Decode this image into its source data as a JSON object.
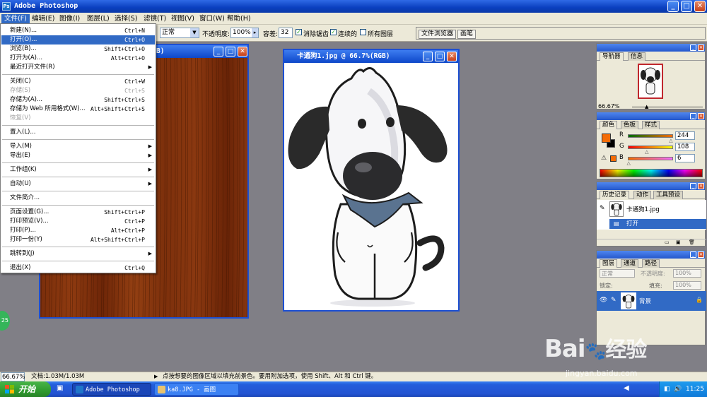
{
  "app": {
    "title": "Adobe Photoshop",
    "icon_letters": "Ps"
  },
  "window_controls": {
    "minimize": "_",
    "maximize": "□",
    "close": "✕"
  },
  "menubar": {
    "items": [
      "文件(F)",
      "编辑(E)",
      "图像(I)",
      "图层(L)",
      "选择(S)",
      "滤镜(T)",
      "视图(V)",
      "窗口(W)",
      "帮助(H)"
    ]
  },
  "options_bar": {
    "blend_mode": "正常",
    "opacity_label": "不透明度:",
    "opacity_value": "100%",
    "tolerance_label": "容差:",
    "tolerance_value": "32",
    "antialias_label": "消除锯齿",
    "antialias_checked": true,
    "contiguous_label": "连续的",
    "contiguous_checked": true,
    "all_layers_label": "所有图层",
    "all_layers_checked": false,
    "palette_well_tabs": [
      "文件浏览器",
      "画笔"
    ]
  },
  "file_menu": {
    "items": [
      {
        "label": "新建(N)...",
        "shortcut": "Ctrl+N",
        "state": "normal"
      },
      {
        "label": "打开(O)...",
        "shortcut": "Ctrl+O",
        "state": "highlighted"
      },
      {
        "label": "浏览(B)...",
        "shortcut": "Shift+Ctrl+O",
        "state": "normal"
      },
      {
        "label": "打开为(A)...",
        "shortcut": "Alt+Ctrl+O",
        "state": "normal"
      },
      {
        "label": "最近打开文件(R)",
        "shortcut": "",
        "state": "submenu"
      },
      {
        "label": "关闭(C)",
        "shortcut": "Ctrl+W",
        "state": "normal"
      },
      {
        "label": "存储(S)",
        "shortcut": "Ctrl+S",
        "state": "disabled"
      },
      {
        "label": "存储为(A)...",
        "shortcut": "Shift+Ctrl+S",
        "state": "normal"
      },
      {
        "label": "存储为 Web 所用格式(W)...",
        "shortcut": "Alt+Shift+Ctrl+S",
        "state": "normal"
      },
      {
        "label": "恢复(V)",
        "shortcut": "",
        "state": "disabled"
      },
      {
        "label": "置入(L)...",
        "shortcut": "",
        "state": "normal"
      },
      {
        "label": "导入(M)",
        "shortcut": "",
        "state": "submenu"
      },
      {
        "label": "导出(E)",
        "shortcut": "",
        "state": "submenu"
      },
      {
        "label": "工作组(K)",
        "shortcut": "",
        "state": "submenu"
      },
      {
        "label": "自动(U)",
        "shortcut": "",
        "state": "submenu"
      },
      {
        "label": "文件简介...",
        "shortcut": "",
        "state": "normal"
      },
      {
        "label": "页面设置(G)...",
        "shortcut": "Shift+Ctrl+P",
        "state": "normal"
      },
      {
        "label": "打印预览(V)...",
        "shortcut": "Ctrl+P",
        "state": "normal"
      },
      {
        "label": "打印(P)...",
        "shortcut": "Alt+Ctrl+P",
        "state": "normal"
      },
      {
        "label": "打印一份(Y)",
        "shortcut": "Alt+Shift+Ctrl+P",
        "state": "normal"
      },
      {
        "label": "跳转到(J)",
        "shortcut": "",
        "state": "submenu"
      },
      {
        "label": "退出(X)",
        "shortcut": "Ctrl+Q",
        "state": "normal"
      }
    ]
  },
  "documents": [
    {
      "title": "B)",
      "content": "wood-texture"
    },
    {
      "title": "卡通狗1.jpg @ 66.7%(RGB)",
      "content": "cartoon-dog"
    }
  ],
  "navigator": {
    "tabs": [
      "导航器",
      "信息"
    ],
    "zoom": "66.67%"
  },
  "color_palette": {
    "tabs": [
      "颜色",
      "色板",
      "样式"
    ],
    "foreground_color": "#f46c06",
    "r_label": "R",
    "r_value": "244",
    "r_fraction": 0.957,
    "g_label": "G",
    "g_value": "108",
    "g_fraction": 0.424,
    "b_label": "B",
    "b_value": "6",
    "b_fraction": 0.024
  },
  "history": {
    "tabs": [
      "历史记录",
      "动作",
      "工具预设"
    ],
    "snapshot": "卡通狗1.jpg",
    "steps": [
      "打开"
    ]
  },
  "layers": {
    "tabs": [
      "图层",
      "通道",
      "路径"
    ],
    "blend_mode": "正常",
    "opacity_label": "不透明度:",
    "opacity_value": "100%",
    "lock_label": "锁定:",
    "fill_label": "填充:",
    "fill_value": "100%",
    "layer_names": [
      "背景"
    ]
  },
  "status_bar": {
    "zoom": "66.67%",
    "doc_info": "文档:1.03M/1.03M",
    "hint": "点按想要的图像区域以填充前景色。要用附加选项，使用 Shift、Alt 和 Ctrl 键。"
  },
  "taskbar": {
    "start_label": "开始",
    "buttons": [
      "Adobe Photoshop",
      "ka8.JPG - 画图"
    ],
    "clock": "11:25"
  },
  "watermark": {
    "brand": "Bai",
    "brand_cn": "经验",
    "url": "jingyan.baidu.com"
  },
  "left_badge": "25"
}
